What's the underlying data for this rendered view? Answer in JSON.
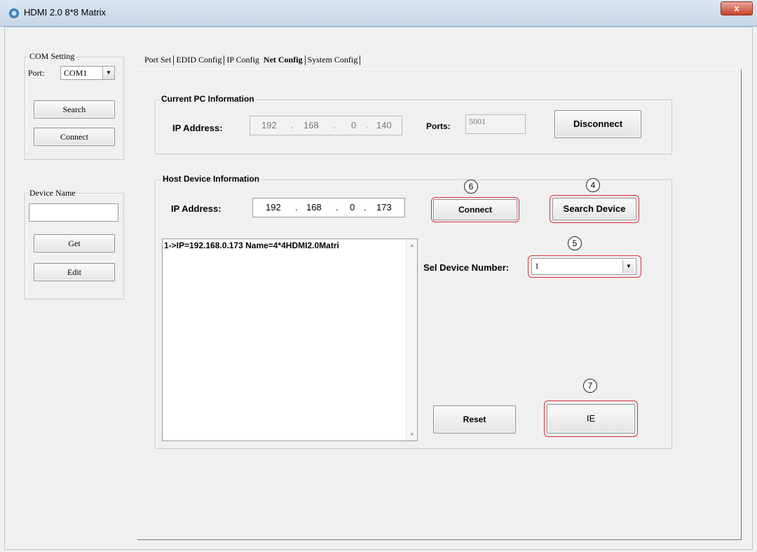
{
  "window": {
    "title": "HDMI 2.0 8*8 Matrix",
    "close": "x"
  },
  "com_setting": {
    "title": "COM Setting",
    "port_label": "Port:",
    "port_value": "COM1",
    "search_label": "Search",
    "connect_label": "Connect"
  },
  "device_name": {
    "title": "Device Name",
    "value": "",
    "get_label": "Get",
    "edit_label": "Edit"
  },
  "tabs": [
    "Port Set",
    "EDID Config",
    "IP Config",
    "Net Config",
    "System Config"
  ],
  "current_pc": {
    "title": "Current PC Information",
    "ip_label": "IP Address:",
    "ip": [
      "192",
      "168",
      "0",
      "140"
    ],
    "ports_label": "Ports:",
    "ports_value": "5001",
    "disconnect_label": "Disconnect"
  },
  "host_device": {
    "title": "Host Device Information",
    "ip_label": "IP Address:",
    "ip": [
      "192",
      "168",
      "0",
      "173"
    ],
    "connect_label": "Connect",
    "search_device_label": "Search Device",
    "list_items": [
      "1->IP=192.168.0.173  Name=4*4HDMI2.0Matri"
    ],
    "sel_device_label": "Sel Device Number:",
    "sel_device_value": "1",
    "reset_label": "Reset",
    "ie_label": "IE"
  },
  "callouts": {
    "search": "4",
    "sel": "5",
    "connect": "6",
    "ie": "7"
  },
  "ip_dot": "."
}
